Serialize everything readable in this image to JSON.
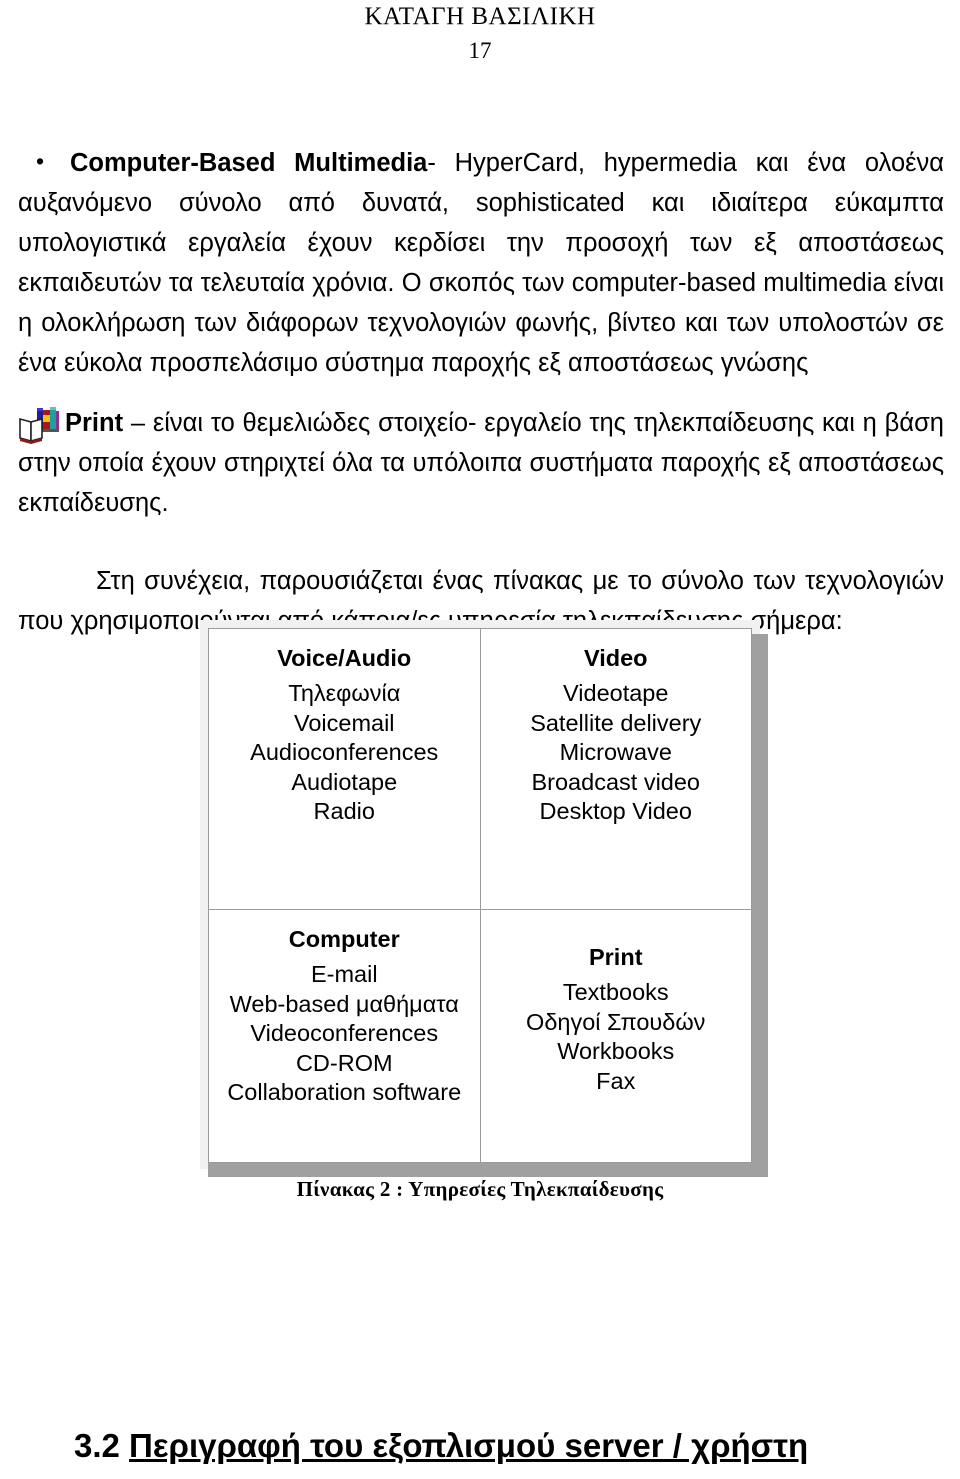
{
  "header": {
    "author": "ΚΑΤΑΓΗ ΒΑΣΙΛΙΚΗ",
    "page_number": "17"
  },
  "body": {
    "bullet_glyph": "•",
    "para1": {
      "bold_lead": "Computer-Based Multimedia",
      "rest": "- HyperCard, hypermedia και ένα ολοένα αυξανόμενο σύνολο από δυνατά, sophisticated και ιδιαίτερα εύκαμπτα υπολογιστικά εργαλεία έχουν κερδίσει την προσοχή των εξ αποστάσεως εκπαιδευτών τα τελευταία χρόνια. Ο σκοπός των computer-based multimedia είναι η ολοκλήρωση των διάφορων τεχνολογιών φωνής, βίντεο και των υπολοστών σε ένα εύκολα προσπελάσιμο σύστημα παροχής εξ αποστάσεως γνώσης"
    },
    "para2": {
      "icon": "books-icon",
      "bold_lead": "Print",
      "rest": " – είναι το θεμελιώδες στοιχείο- εργαλείο της τηλεκπαίδευσης και η βάση στην οποία έχουν στηριχτεί όλα τα υπόλοιπα συστήματα παροχής εξ αποστάσεως εκπαίδευσης."
    },
    "para3": "Στη συνέχεια, παρουσιάζεται ένας πίνακας με το σύνολο των τεχνολογιών που χρησιμοποιούνται από κάποια/ες υπηρεσία τηλεκπαίδευσης σήμερα:"
  },
  "table": {
    "caption": "Πίνακας 2 : Υπηρεσίες Τηλεκπαίδευσης",
    "cells": [
      {
        "title": "Voice/Audio",
        "items": [
          "Τηλεφωνία",
          "Voicemail",
          "Audioconferences",
          "Audiotape",
          "Radio"
        ]
      },
      {
        "title": "Video",
        "items": [
          "Videotape",
          "Satellite delivery",
          "Microwave",
          "Broadcast video",
          "Desktop Video"
        ]
      },
      {
        "title": "Computer",
        "items": [
          "E-mail",
          "Web-based μαθήματα",
          "Videoconferences",
          "CD-ROM",
          "Collaboration software"
        ]
      },
      {
        "title": "Print",
        "items": [
          "Textbooks",
          "Οδηγοί Σπουδών",
          "Workbooks",
          "Fax"
        ]
      }
    ]
  },
  "section_heading": {
    "number": "3.2 ",
    "title": "Περιγραφή του εξοπλισμού server / χρήστη"
  },
  "colors": {
    "text": "#000000",
    "table_frame": "#f1f1f1",
    "table_shadow": "#a0a0a0",
    "cell_border": "#9a9a9a"
  }
}
